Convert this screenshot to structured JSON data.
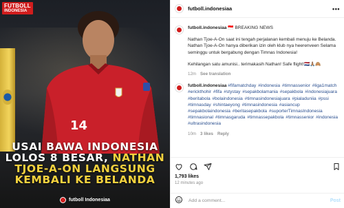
{
  "image": {
    "logo_line1": "FUTBOLL",
    "logo_line2": "INDONESIA",
    "jersey_number": "14",
    "headline_line1": "USAI BAWA INDONESIA",
    "headline_line2_white": "LOLOS 8 BESAR,",
    "headline_line2_yellow": "NATHAN",
    "headline_line3": "TJOE-A-ON LANGSUNG",
    "headline_line4": "KEMBALI KE BELANDA",
    "footer_handle": "futboll Indonesiaa"
  },
  "header": {
    "username": "futboll.indonesiaa",
    "more_icon": "ellipsis-icon"
  },
  "caption": {
    "username": "futboll.indonesiaa",
    "flag": "🇮🇩",
    "title": "BREAKING NEWS",
    "para1": "Nathan Tjoe-A-On saat ini tengah perjalanan kembali menuju ke Belanda. Nathan Tjoe-A-On hanya diberikan izin oleh klub nya heerenveen Selama seminggu untuk bergabung dengan Timnas Indonesia!",
    "para2": "Kehilangan satu amunisi.. terimakasih Nathan! Safe flight!🇳🇱🙏🏽🙈",
    "time": "12m",
    "see_translation": "See translation"
  },
  "comment": {
    "username": "futboll.indonesiaa",
    "text": "#fifamatchday #indonesia #timnassenior #liga1match #erickthohir #fifa #stystay #sepakbolamania #sepakbola #indonesiajuara #beritabola #bolaindonesia #timnasindonesiajuara #pialaduniia #pssi #timnasday #shintaeyong #timnasindonesia #asiancup #sepakbolaindonesia #beritasepakbola #suporterTimnasIndonesia #timnasional #timnasgaruda #timnassepakbola #timnassenior #indonesia #ultrasindonesia",
    "time": "10m",
    "likes": "3 likes",
    "reply": "Reply"
  },
  "actions": {
    "like_icon": "heart-icon",
    "comment_icon": "comment-icon",
    "share_icon": "send-icon",
    "save_icon": "bookmark-icon"
  },
  "stats": {
    "likes": "1,793 likes",
    "time_ago": "12 minutes ago"
  },
  "add_comment": {
    "placeholder": "Add a comment...",
    "post_label": "Post"
  },
  "colors": {
    "brand_red": "#d11d1d",
    "headline_yellow": "#f4d23e",
    "hashtag_blue": "#2a4f8f",
    "post_disabled": "#b2dffc"
  }
}
